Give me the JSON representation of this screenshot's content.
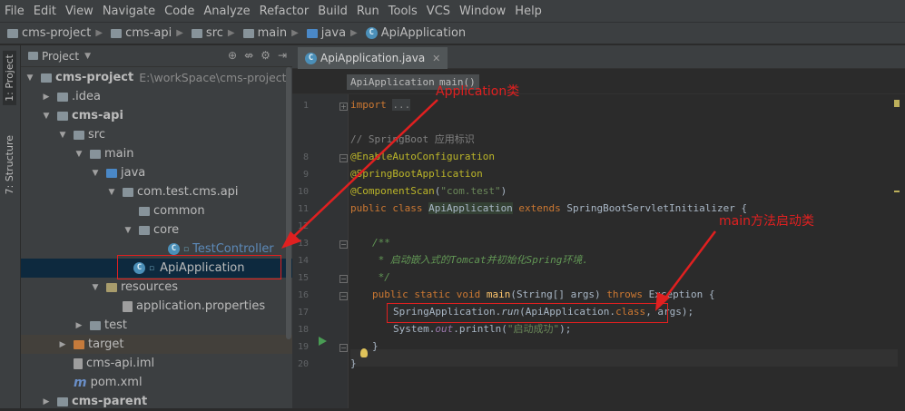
{
  "menu": [
    "File",
    "Edit",
    "View",
    "Navigate",
    "Code",
    "Analyze",
    "Refactor",
    "Build",
    "Run",
    "Tools",
    "VCS",
    "Window",
    "Help"
  ],
  "breadcrumb": [
    "cms-project",
    "cms-api",
    "src",
    "main",
    "java",
    "ApiApplication"
  ],
  "tool_windows": {
    "project": "1: Project",
    "structure": "7: Structure"
  },
  "project_panel": {
    "title": "Project",
    "items": [
      {
        "label": "cms-project",
        "path": "E:\\workSpace\\cms-project"
      },
      {
        "label": ".idea"
      },
      {
        "label": "cms-api"
      },
      {
        "label": "src"
      },
      {
        "label": "main"
      },
      {
        "label": "java"
      },
      {
        "label": "com.test.cms.api"
      },
      {
        "label": "common"
      },
      {
        "label": "core"
      },
      {
        "label": "TestController"
      },
      {
        "label": "ApiApplication"
      },
      {
        "label": "resources"
      },
      {
        "label": "application.properties"
      },
      {
        "label": "test"
      },
      {
        "label": "target"
      },
      {
        "label": "cms-api.iml"
      },
      {
        "label": "pom.xml"
      },
      {
        "label": "cms-parent"
      }
    ]
  },
  "editor": {
    "tab": "ApiApplication.java",
    "crumbs": [
      "ApiApplication",
      "main()"
    ],
    "line_numbers": [
      "1",
      "",
      "",
      "8",
      "9",
      "10",
      "11",
      "12",
      "13",
      "14",
      "15",
      "16",
      "17",
      "18",
      "19",
      "20"
    ],
    "code": {
      "l1_kw": "import",
      "l1_dots": "...",
      "l3": "// SpringBoot 应用标识",
      "l4": "@EnableAutoConfiguration",
      "l5": "@SpringBootApplication",
      "l6_an": "@ComponentScan",
      "l6_p1": "(",
      "l6_str": "\"com.test\"",
      "l6_p2": ")",
      "l7_kw": "public class ",
      "l7_cls": "ApiApplication",
      "l7_ext": " extends ",
      "l7_rest": "SpringBootServletInitializer {",
      "l9": "/**",
      "l10": " * 启动嵌入式的Tomcat并初始化Spring环境.",
      "l11": " */",
      "l12_kw": "public static void ",
      "l12_fn": "main",
      "l12_args": "(String[] args) ",
      "l12_kw2": "throws ",
      "l12_rest": "Exception {",
      "l13_a": "SpringApplication.",
      "l13_b": "run",
      "l13_c": "(ApiApplication.",
      "l13_kw": "class",
      "l13_d": ", args);",
      "l14_a": "System.",
      "l14_fd": "out",
      "l14_b": ".println(",
      "l14_str": "\"启动成功\"",
      "l14_c": ");",
      "l15": "}",
      "l16": "}"
    }
  },
  "annotations": {
    "application_class": "Application类",
    "main_method": "main方法启动类"
  },
  "colors": {
    "annotation": "#e02020",
    "selection": "#0d293e"
  }
}
